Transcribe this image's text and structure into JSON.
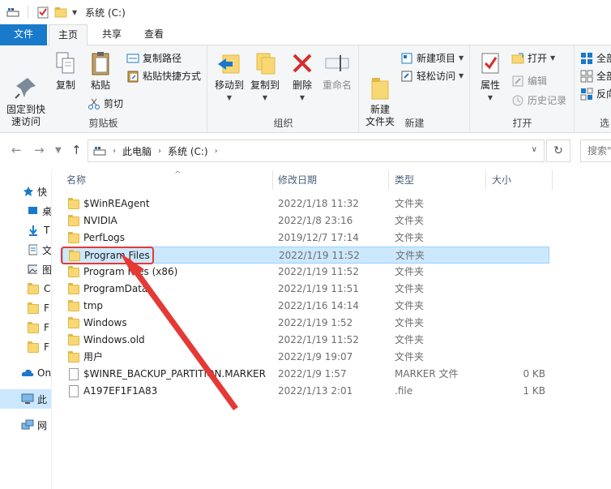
{
  "window": {
    "title": "系统 (C:)"
  },
  "tabs": [
    "文件",
    "主页",
    "共享",
    "查看"
  ],
  "ribbon": {
    "clipboard": {
      "label": "剪贴板",
      "pin": "固定到快\n速访问",
      "copy": "复制",
      "paste": "粘贴",
      "copy_path": "复制路径",
      "paste_shortcut": "粘贴快捷方式",
      "cut": "剪切"
    },
    "organize": {
      "label": "组织",
      "move_to": "移动到",
      "copy_to": "复制到",
      "delete": "删除",
      "rename": "重命名"
    },
    "new": {
      "label": "新建",
      "new_folder": "新建\n文件夹",
      "new_item": "新建项目",
      "easy_access": "轻松访问"
    },
    "open": {
      "label": "打开",
      "properties": "属性",
      "open": "打开",
      "edit": "编辑",
      "history": "历史记录"
    },
    "select": {
      "label": "选",
      "select_all": "全部",
      "select_none": "全部",
      "invert": "反向"
    }
  },
  "address": {
    "crumbs": [
      "此电脑",
      "系统 (C:)"
    ],
    "search_placeholder": "搜索\""
  },
  "navpane": {
    "items": [
      {
        "label": "快",
        "icon": "star-icon"
      },
      {
        "label": "桌",
        "icon": "desktop-icon"
      },
      {
        "label": "T",
        "icon": "download-icon"
      },
      {
        "label": "文",
        "icon": "document-icon"
      },
      {
        "label": "图",
        "icon": "picture-icon"
      },
      {
        "label": "C",
        "icon": "folder-icon"
      },
      {
        "label": "F",
        "icon": "folder-icon"
      },
      {
        "label": "F",
        "icon": "folder-icon"
      },
      {
        "label": "F",
        "icon": "folder-icon"
      },
      {
        "label": "On",
        "icon": "cloud-icon"
      },
      {
        "label": "此",
        "icon": "computer-icon"
      },
      {
        "label": "网",
        "icon": "network-icon"
      }
    ]
  },
  "columns": {
    "name": "名称",
    "date": "修改日期",
    "type": "类型",
    "size": "大小"
  },
  "files": [
    {
      "name": "$WinREAgent",
      "date": "2022/1/18 11:32",
      "type": "文件夹",
      "size": "",
      "kind": "folder"
    },
    {
      "name": "NVIDIA",
      "date": "2022/1/8 23:16",
      "type": "文件夹",
      "size": "",
      "kind": "folder"
    },
    {
      "name": "PerfLogs",
      "date": "2019/12/7 17:14",
      "type": "文件夹",
      "size": "",
      "kind": "folder"
    },
    {
      "name": "Program Files",
      "date": "2022/1/19 11:52",
      "type": "文件夹",
      "size": "",
      "kind": "folder"
    },
    {
      "name": "Program Files (x86)",
      "date": "2022/1/19 11:52",
      "type": "文件夹",
      "size": "",
      "kind": "folder"
    },
    {
      "name": "ProgramData",
      "date": "2022/1/19 11:51",
      "type": "文件夹",
      "size": "",
      "kind": "folder"
    },
    {
      "name": "tmp",
      "date": "2022/1/16 14:14",
      "type": "文件夹",
      "size": "",
      "kind": "folder"
    },
    {
      "name": "Windows",
      "date": "2022/1/19 1:52",
      "type": "文件夹",
      "size": "",
      "kind": "folder"
    },
    {
      "name": "Windows.old",
      "date": "2022/1/19 11:52",
      "type": "文件夹",
      "size": "",
      "kind": "folder"
    },
    {
      "name": "用户",
      "date": "2022/1/9 19:07",
      "type": "文件夹",
      "size": "",
      "kind": "folder"
    },
    {
      "name": "$WINRE_BACKUP_PARTITION.MARKER",
      "date": "2022/1/9 1:57",
      "type": "MARKER 文件",
      "size": "0 KB",
      "kind": "file"
    },
    {
      "name": "A197EF1F1A83",
      "date": "2022/1/13 2:01",
      "type": ".file",
      "size": "1 KB",
      "kind": "file"
    }
  ],
  "colors": {
    "accent": "#1979ca",
    "selected_bg": "#cce8ff",
    "annotation": "#e53935"
  }
}
